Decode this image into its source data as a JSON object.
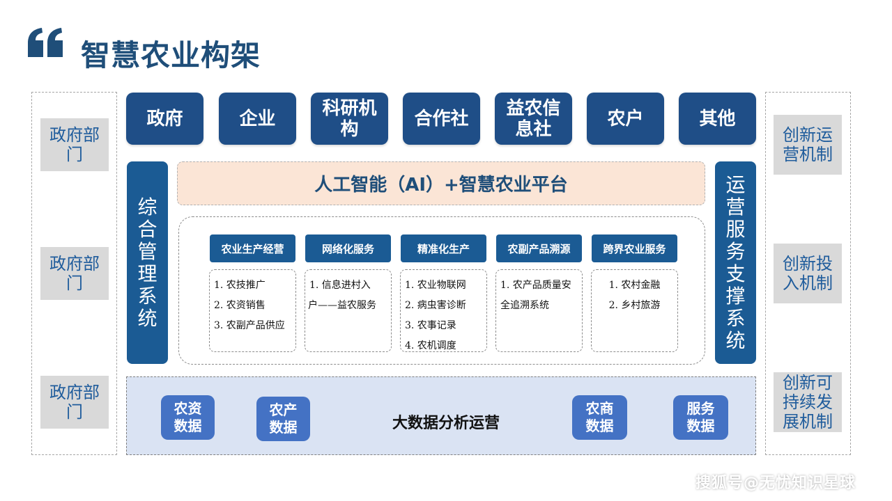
{
  "title": "智慧农业构架",
  "left_column": {
    "items": [
      "政府部门",
      "政府部门",
      "政府部门"
    ]
  },
  "right_column": {
    "items": [
      "创新运营机制",
      "创新投入机制",
      "创新可持续发展机制"
    ]
  },
  "stakeholders": [
    "政府",
    "企业",
    "科研机构",
    "合作社",
    "益农信息社",
    "农户",
    "其他"
  ],
  "left_system": "综合管理系统",
  "right_system": "运营服务支撑系统",
  "platform_banner": "人工智能（AI）+智慧农业平台",
  "services": [
    {
      "title": "农业生产经营",
      "lines": [
        "1. 农技推广",
        "2. 农资销售",
        "3. 农副产品供应"
      ]
    },
    {
      "title": "网络化服务",
      "lines": [
        "1. 信息进村入",
        "户——益农服务"
      ]
    },
    {
      "title": "精准化生产",
      "lines": [
        "1. 农业物联网",
        "2. 病虫害诊断",
        "3. 农事记录",
        "4. 农机调度"
      ]
    },
    {
      "title": "农副产品溯源",
      "lines": [
        "1. 农产品质量安",
        "全追溯系统"
      ]
    },
    {
      "title": "跨界农业服务",
      "lines": [
        "1. 农村金融",
        "2. 乡村旅游"
      ]
    }
  ],
  "data_section": {
    "center_label": "大数据分析运营",
    "items": [
      "农资数据",
      "农产数据",
      "农商数据",
      "服务数据"
    ]
  },
  "watermark": "搜狐号@无忧知识星球",
  "colors": {
    "navy": "#1f4e87",
    "blue": "#1b5b94",
    "data_blue": "#4472c4",
    "peach": "#fbe5d6",
    "light_blue": "#dae3f3",
    "gray": "#d9d9d9"
  },
  "icons": {
    "title_mark": "quote-icon"
  }
}
